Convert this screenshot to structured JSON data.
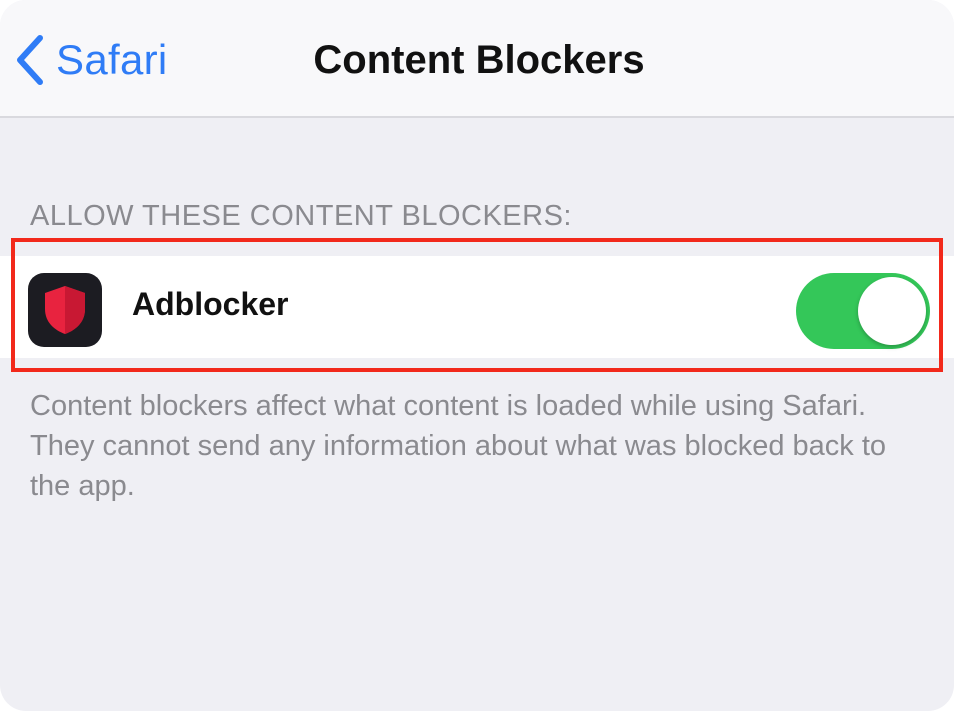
{
  "nav": {
    "back_label": "Safari",
    "title": "Content Blockers"
  },
  "section": {
    "header": "ALLOW THESE CONTENT BLOCKERS:",
    "items": [
      {
        "label": "Adblocker",
        "icon": "shield-icon",
        "toggle_on": true
      }
    ],
    "footer": "Content blockers affect what content is loaded while using Safari. They cannot send any information about what was blocked back to the app."
  },
  "colors": {
    "accent": "#2f7cf6",
    "toggle_on": "#34c759",
    "highlight": "#f2291b",
    "shield": "#e8233f"
  }
}
